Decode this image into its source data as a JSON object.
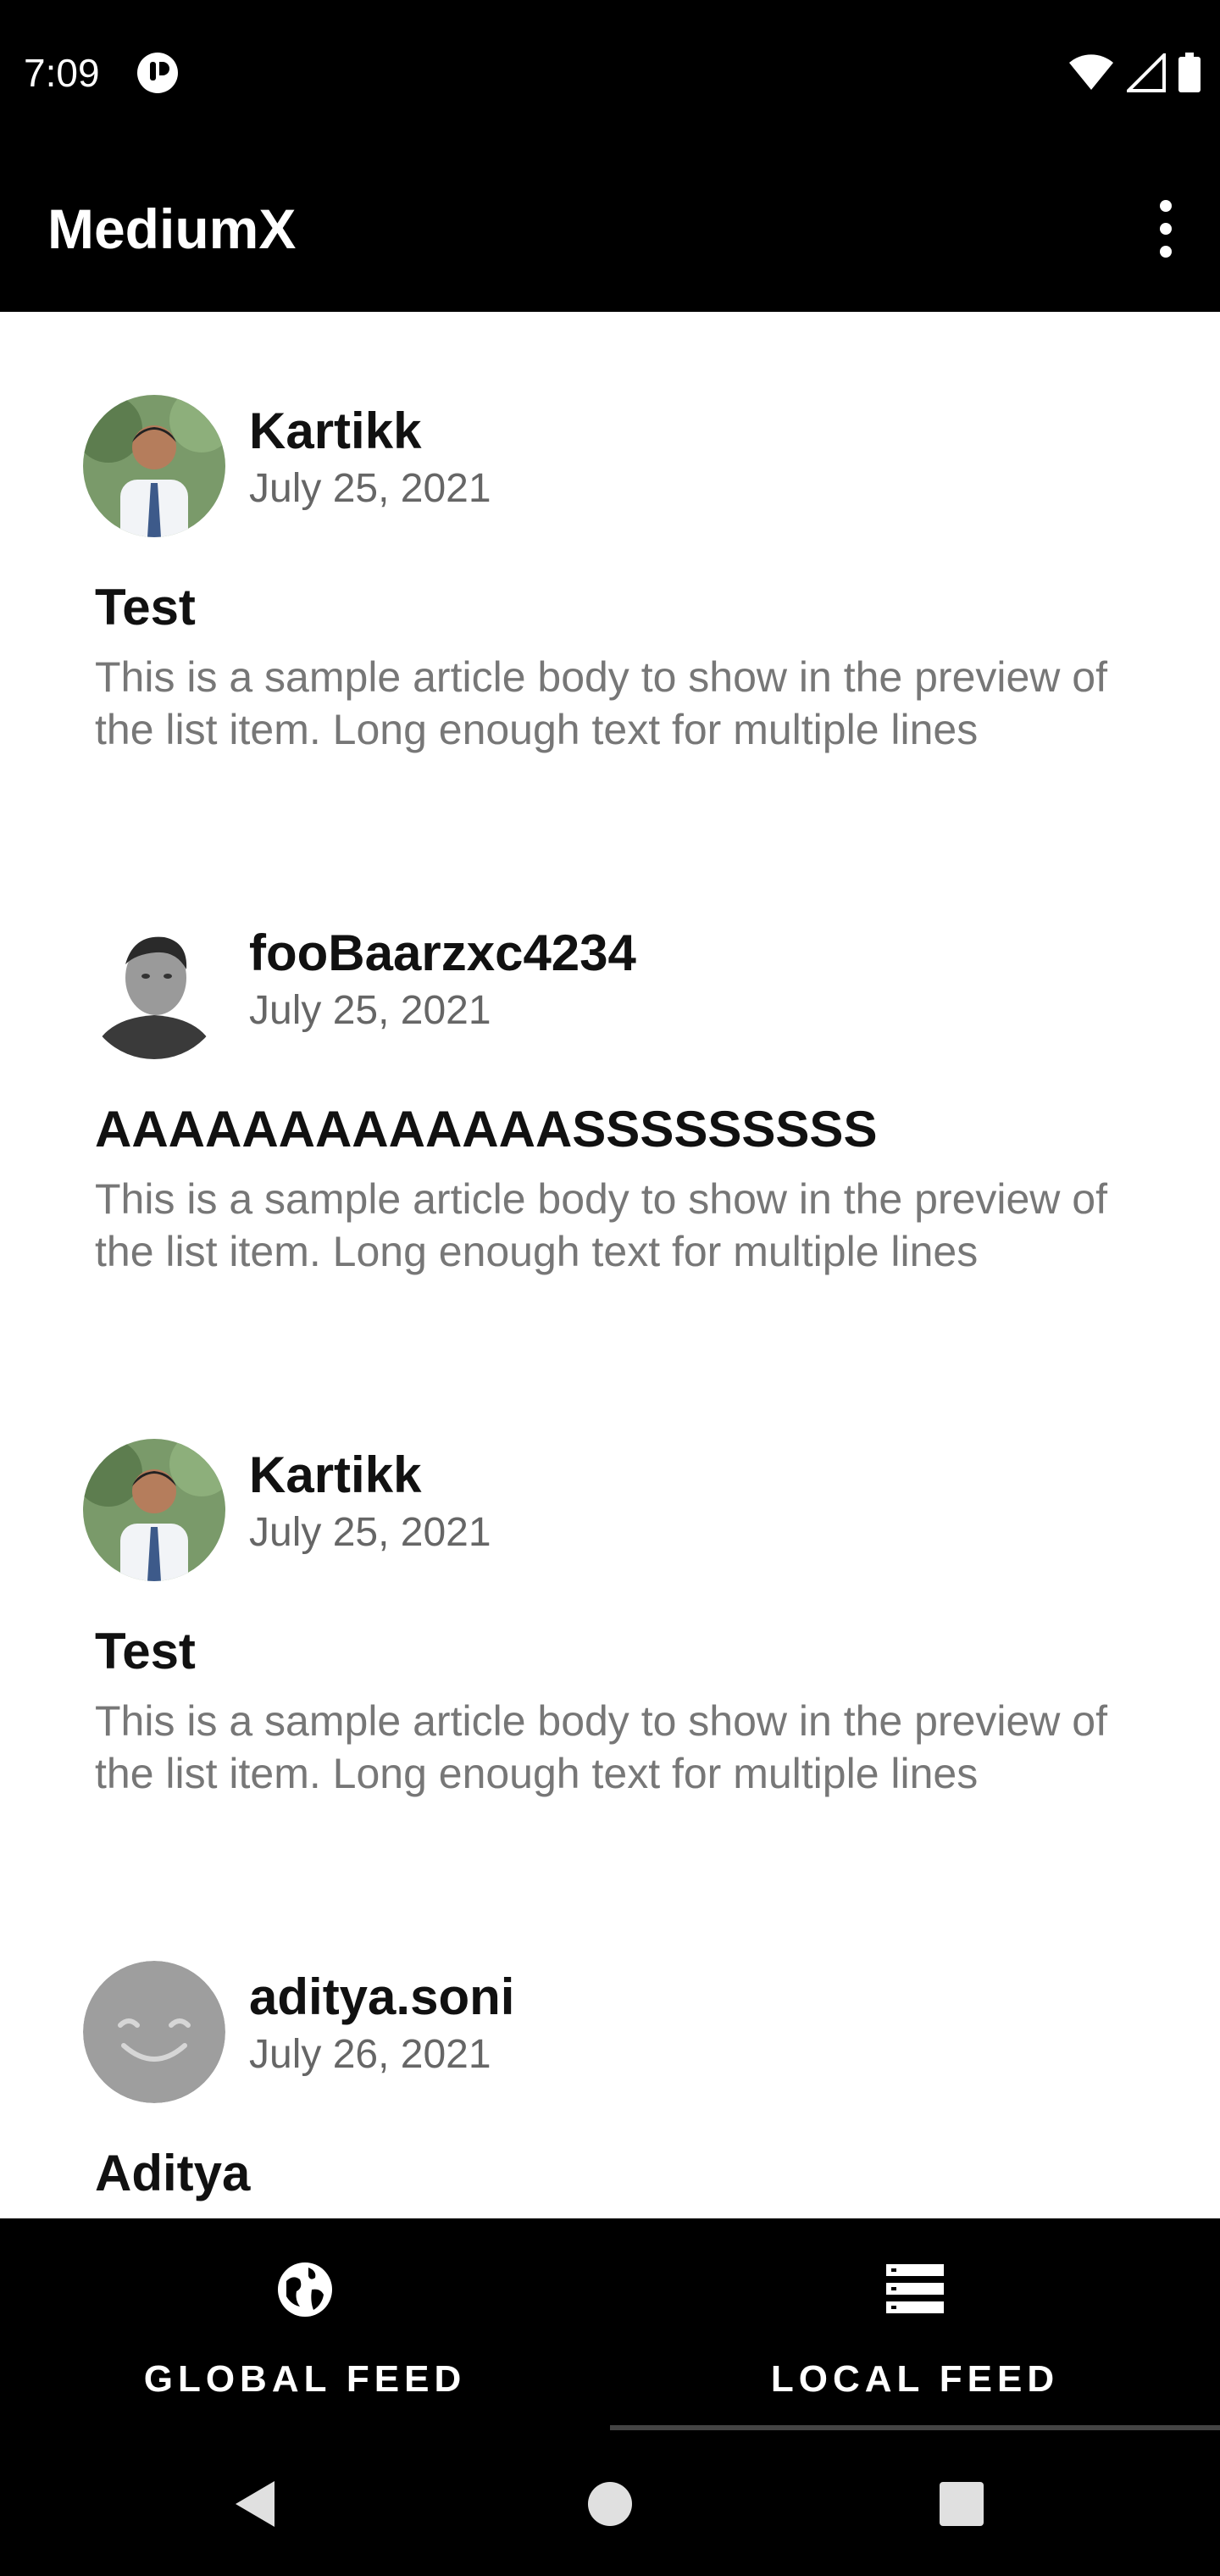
{
  "status_bar": {
    "time": "7:09",
    "icons": [
      "app-notification-icon",
      "wifi-icon",
      "cell-signal-icon",
      "battery-icon"
    ]
  },
  "app_bar": {
    "title": "MediumX",
    "menu_icon": "more-vert-icon"
  },
  "articles": [
    {
      "author": "Kartikk",
      "date": "July 25, 2021",
      "title": "Test",
      "body": "This is a sample article body to show in the preview of the list item. Long enough text for multiple lines",
      "avatar": "photo-avatar-man-tie"
    },
    {
      "author": "fooBaarzxc4234",
      "date": "July 25, 2021",
      "title": "AAAAAAAAAAAAASSSSSSSSS",
      "body": "This is a sample article body to show in the preview of the list item. Long enough text for multiple lines",
      "avatar": "photo-avatar-man-bw"
    },
    {
      "author": "Kartikk",
      "date": "July 25, 2021",
      "title": "Test",
      "body": "This is a sample article body to show in the preview of the list item. Long enough text for multiple lines",
      "avatar": "photo-avatar-man-tie"
    },
    {
      "author": "aditya.soni",
      "date": "July 26, 2021",
      "title": "Aditya",
      "body": "",
      "avatar": "smiley-avatar"
    }
  ],
  "bottom_nav": {
    "tabs": [
      {
        "label": "GLOBAL FEED",
        "icon": "globe-icon",
        "selected": false
      },
      {
        "label": "LOCAL FEED",
        "icon": "list-icon",
        "selected": true
      }
    ]
  },
  "system_nav": {
    "buttons": [
      "back-icon",
      "home-icon",
      "recents-icon"
    ]
  },
  "colors": {
    "bar_background": "#000000",
    "content_background": "#ffffff",
    "secondary_text": "#777777"
  }
}
